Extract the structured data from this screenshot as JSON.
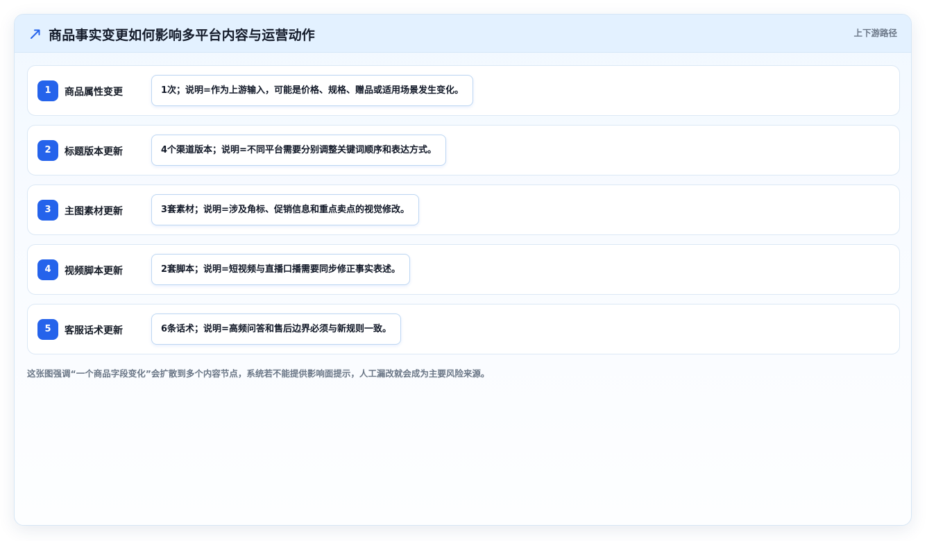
{
  "header": {
    "icon": "trend-arrow-icon",
    "title": "商品事实变更如何影响多平台内容与运营动作",
    "tag": "上下游路径"
  },
  "accent_color": "#2563eb",
  "steps": [
    {
      "num": "1",
      "label": "商品属性变更",
      "detail": "1次；说明=作为上游输入，可能是价格、规格、赠品或适用场景发生变化。"
    },
    {
      "num": "2",
      "label": "标题版本更新",
      "detail": "4个渠道版本；说明=不同平台需要分别调整关键词顺序和表达方式。"
    },
    {
      "num": "3",
      "label": "主图素材更新",
      "detail": "3套素材；说明=涉及角标、促销信息和重点卖点的视觉修改。"
    },
    {
      "num": "4",
      "label": "视频脚本更新",
      "detail": "2套脚本；说明=短视频与直播口播需要同步修正事实表述。"
    },
    {
      "num": "5",
      "label": "客服话术更新",
      "detail": "6条话术；说明=高频问答和售后边界必须与新规则一致。"
    }
  ],
  "footnote": "这张图强调“一个商品字段变化”会扩散到多个内容节点，系统若不能提供影响面提示，人工漏改就会成为主要风险来源。"
}
